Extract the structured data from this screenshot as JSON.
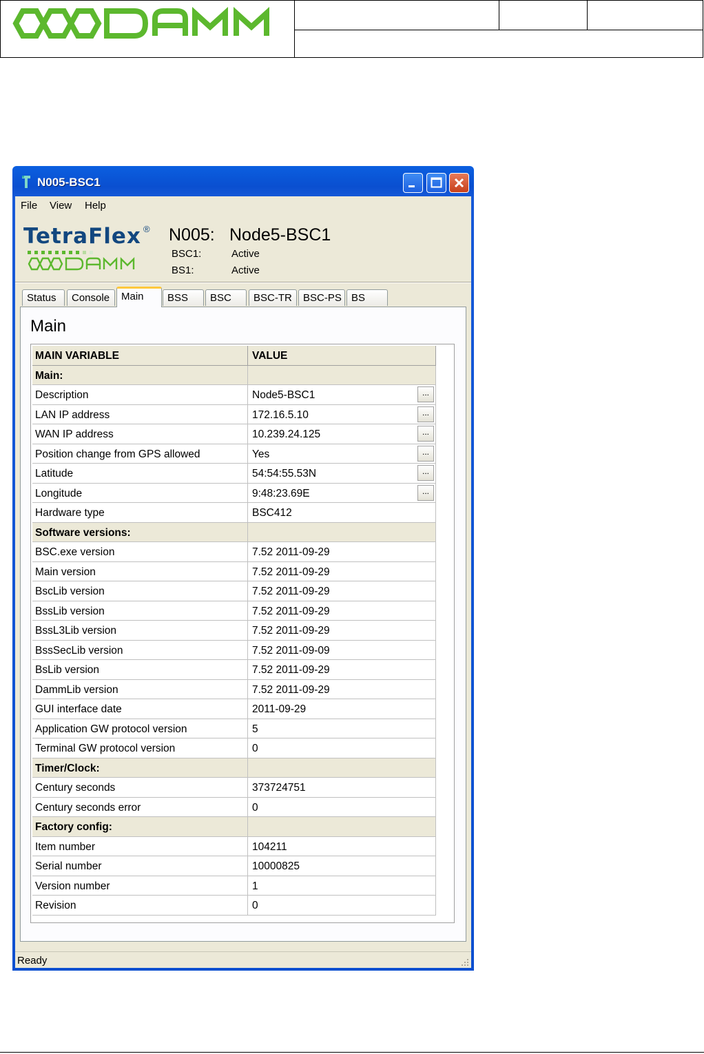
{
  "window": {
    "title": "N005-BSC1"
  },
  "menu": [
    "File",
    "View",
    "Help"
  ],
  "header": {
    "brand": "TetraFlex",
    "brand_mark": "®",
    "node_id": "N005:",
    "node_name": "Node5-BSC1",
    "status": [
      {
        "label": "BSC1:",
        "value": "Active"
      },
      {
        "label": "BS1:",
        "value": "Active"
      }
    ]
  },
  "tabs": [
    "Status",
    "Console",
    "Main",
    "BSS",
    "BSC",
    "BSC-TR",
    "BSC-PS",
    "BS"
  ],
  "active_tab": "Main",
  "page_title": "Main",
  "grid": {
    "columns": [
      "MAIN VARIABLE",
      "VALUE"
    ],
    "rows": [
      {
        "name": "Main:",
        "section": true
      },
      {
        "name": "Description",
        "value": "Node5-BSC1",
        "edit": true
      },
      {
        "name": "LAN IP address",
        "value": "172.16.5.10",
        "edit": true
      },
      {
        "name": "WAN IP address",
        "value": "10.239.24.125",
        "edit": true
      },
      {
        "name": "Position change from GPS allowed",
        "value": "Yes",
        "edit": true
      },
      {
        "name": "Latitude",
        "value": "54:54:55.53N",
        "edit": true
      },
      {
        "name": "Longitude",
        "value": "9:48:23.69E",
        "edit": true
      },
      {
        "name": "Hardware type",
        "value": "BSC412"
      },
      {
        "name": "Software versions:",
        "section": true
      },
      {
        "name": "BSC.exe version",
        "value": "7.52 2011-09-29"
      },
      {
        "name": "Main version",
        "value": "7.52 2011-09-29"
      },
      {
        "name": "BscLib version",
        "value": "7.52 2011-09-29"
      },
      {
        "name": "BssLib version",
        "value": "7.52 2011-09-29"
      },
      {
        "name": "BssL3Lib version",
        "value": "7.52 2011-09-29"
      },
      {
        "name": "BssSecLib version",
        "value": "7.52 2011-09-09"
      },
      {
        "name": "BsLib version",
        "value": "7.52 2011-09-29"
      },
      {
        "name": "DammLib version",
        "value": "7.52 2011-09-29"
      },
      {
        "name": "GUI interface date",
        "value": "2011-09-29"
      },
      {
        "name": "Application GW protocol version",
        "value": "5"
      },
      {
        "name": "Terminal GW protocol version",
        "value": "0"
      },
      {
        "name": "Timer/Clock:",
        "section": true
      },
      {
        "name": "Century seconds",
        "value": "373724751"
      },
      {
        "name": "Century seconds error",
        "value": "0"
      },
      {
        "name": "Factory config:",
        "section": true
      },
      {
        "name": "Item number",
        "value": "104211"
      },
      {
        "name": "Serial number",
        "value": "10000825"
      },
      {
        "name": "Version number",
        "value": "1"
      },
      {
        "name": "Revision",
        "value": "0"
      }
    ],
    "edit_button_label": "..."
  },
  "statusbar": {
    "text": "Ready"
  },
  "colors": {
    "brand_green": "#5cb82e",
    "brand_blue": "#12477f",
    "title_bar": "#0a4fd0"
  }
}
